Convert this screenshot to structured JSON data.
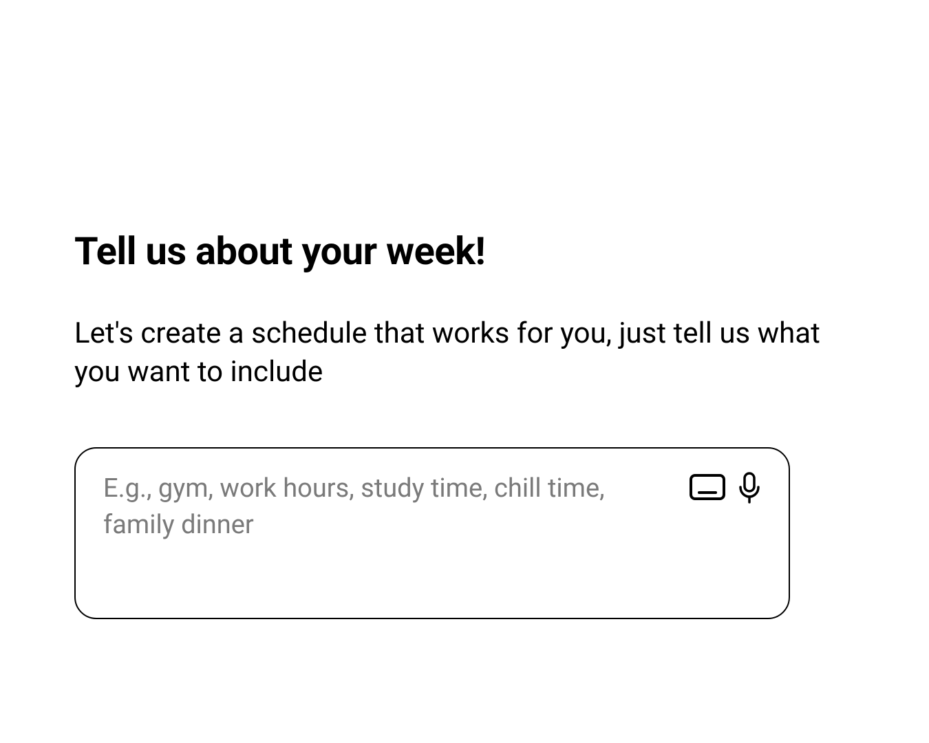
{
  "main": {
    "heading": "Tell us about your week!",
    "subheading": "Let's create a schedule that works for you, just tell us what you want to include",
    "input": {
      "placeholder": "E.g., gym, work hours, study time, chill time, family dinner",
      "value": ""
    },
    "icons": {
      "keyboard": "keyboard-icon",
      "microphone": "microphone-icon"
    }
  }
}
